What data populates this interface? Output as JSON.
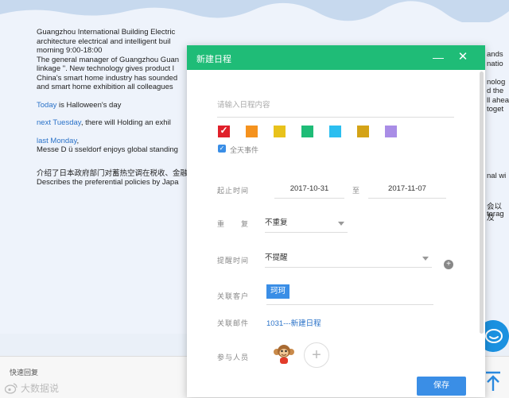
{
  "email": {
    "lines": [
      "Guangzhou International Building Electric",
      "architecture electrical and intelligent buil",
      "morning 9:00-18:00",
      "The general manager of Guangzhou Guan",
      "linkage \". New technology gives product l",
      "China's smart home industry has sounded",
      "and smart home exhibition all colleagues"
    ],
    "right_fragments": [
      "ands",
      "natio",
      "",
      "nolog",
      "d the",
      "ll ahea",
      "toget"
    ],
    "today_link": "Today",
    "today_rest": " is Halloween's day",
    "next_tuesday_link": "next Tuesday",
    "next_tuesday_rest": ", there will Holding  an exhil",
    "last_monday_link": "last Monday",
    "last_monday_rest": ",",
    "messe_line": "Messe D ü sseldorf enjoys global standing",
    "messe_right": "nal wi",
    "cn_line": "介绍了日本政府部门对蓄热空调在税收、金融",
    "cn_right": "会以及",
    "describes_line": "Describes the preferential policies by Japa",
    "describes_right": "torag"
  },
  "quick_reply": {
    "label": "快速回复"
  },
  "watermark": {
    "text": "大数据说"
  },
  "dialog": {
    "title": "新建日程",
    "minimize_glyph": "—",
    "close_glyph": "✕",
    "title_placeholder": "请输入日程内容",
    "colors": [
      "#e0202a",
      "#f5921e",
      "#e8c21b",
      "#1fbc77",
      "#2bbef0",
      "#d4a317",
      "#a98de6"
    ],
    "selected_color_index": 0,
    "check_glyph": "✓",
    "allday_label": "全天事件",
    "time_label": "起止时间",
    "start_date": "2017-10-31",
    "to_label": "至",
    "end_date": "2017-11-07",
    "repeat_label": "重　　复",
    "repeat_value": "不重复",
    "remind_label": "提醒时间",
    "remind_value": "不提醒",
    "customer_label": "关联客户",
    "customer_tag": "珂珂",
    "mail_label": "关联邮件",
    "mail_link": "1031---新建日程",
    "participants_label": "参与人员",
    "add_glyph": "+",
    "save_label": "保存"
  }
}
